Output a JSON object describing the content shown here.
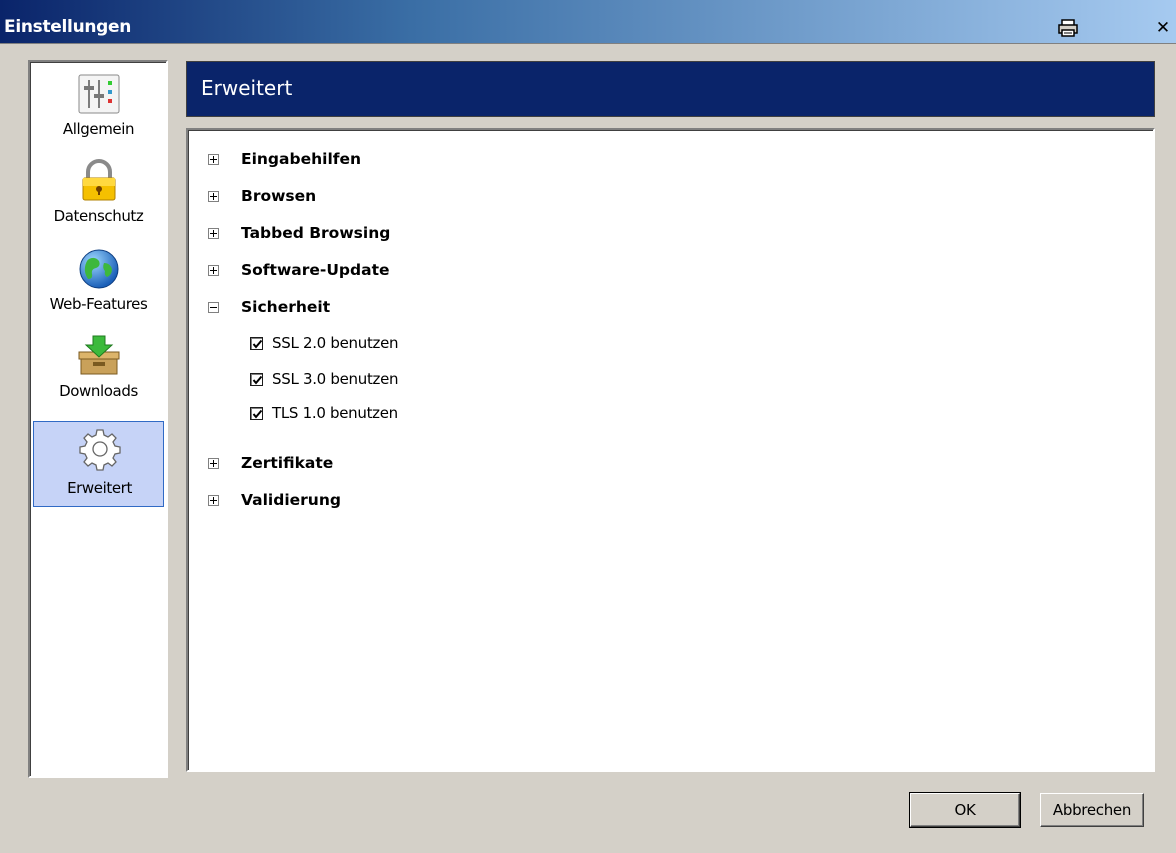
{
  "window": {
    "title": "Einstellungen",
    "print_icon": "printer-icon",
    "close_icon": "close-icon",
    "close_glyph": "✕"
  },
  "sidebar": {
    "items": [
      {
        "label": "Allgemein",
        "icon": "sliders-icon",
        "selected": false
      },
      {
        "label": "Datenschutz",
        "icon": "padlock-icon",
        "selected": false
      },
      {
        "label": "Web-Features",
        "icon": "globe-icon",
        "selected": false
      },
      {
        "label": "Downloads",
        "icon": "download-box-icon",
        "selected": false
      },
      {
        "label": "Erweitert",
        "icon": "gear-icon",
        "selected": true
      }
    ]
  },
  "header": {
    "title": "Erweitert"
  },
  "sections": [
    {
      "label": "Eingabehilfen",
      "expanded": false
    },
    {
      "label": "Browsen",
      "expanded": false
    },
    {
      "label": "Tabbed Browsing",
      "expanded": false
    },
    {
      "label": "Software-Update",
      "expanded": false
    },
    {
      "label": "Sicherheit",
      "expanded": true
    },
    {
      "label": "Zertifikate",
      "expanded": false
    },
    {
      "label": "Validierung",
      "expanded": false
    }
  ],
  "security_options": [
    {
      "label": "SSL 2.0 benutzen",
      "checked": true
    },
    {
      "label": "SSL 3.0 benutzen",
      "checked": true
    },
    {
      "label": "TLS 1.0 benutzen",
      "checked": true
    }
  ],
  "buttons": {
    "ok": "OK",
    "cancel": "Abbrechen"
  },
  "colors": {
    "header_bg": "#0a246a",
    "selection_bg": "#c6d3f7",
    "dialog_bg": "#d4d0c8"
  }
}
